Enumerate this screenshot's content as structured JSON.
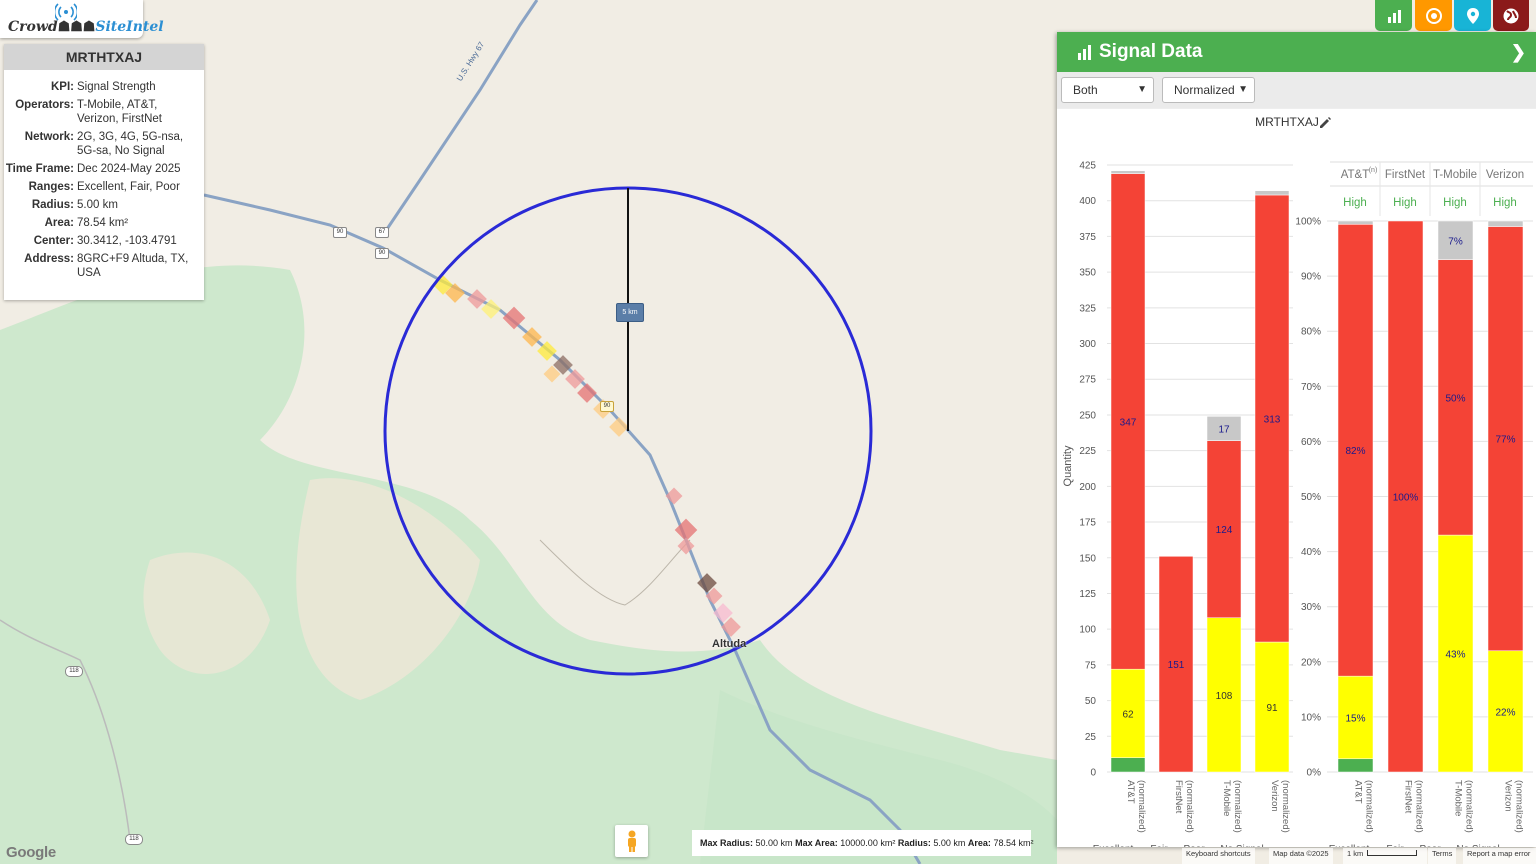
{
  "app": {
    "logo_prefix": "Crowd",
    "logo_suffix": "SiteIntel"
  },
  "info": {
    "title": "MRTHTXAJ",
    "rows": [
      {
        "key": "KPI:",
        "value": "Signal Strength"
      },
      {
        "key": "Operators:",
        "value": "T-Mobile, AT&T, Verizon, FirstNet"
      },
      {
        "key": "Network:",
        "value": "2G, 3G, 4G, 5G-nsa, 5G-sa, No Signal"
      },
      {
        "key": "Time Frame:",
        "value": "Dec 2024-May 2025"
      },
      {
        "key": "Ranges:",
        "value": "Excellent, Fair, Poor"
      },
      {
        "key": "Radius:",
        "value": "5.00 km"
      },
      {
        "key": "Area:",
        "value": "78.54 km²"
      },
      {
        "key": "Center:",
        "value": "30.3412, -103.4791"
      },
      {
        "key": "Address:",
        "value": "8GRC+F9 Altuda, TX, USA"
      }
    ]
  },
  "map": {
    "road_label": "U.S. Hwy 67",
    "shields": [
      "90",
      "67",
      "90",
      "90",
      "118",
      "118"
    ],
    "place_label": "Altuda",
    "scale_label": "5 km",
    "circle_color": "#2a2ad6"
  },
  "toolbar": {
    "buttons": [
      {
        "name": "chart-button",
        "icon": "bar-chart-icon",
        "color": "#4caf50"
      },
      {
        "name": "target-button",
        "icon": "target-icon",
        "color": "#ff9800"
      },
      {
        "name": "pin-button",
        "icon": "map-pin-icon",
        "color": "#18b4d6"
      },
      {
        "name": "globe-button",
        "icon": "globe-icon",
        "color": "#8b1a1a"
      }
    ]
  },
  "panel": {
    "title": "Signal Data",
    "select_mode": "Both",
    "select_scale": "Normalized",
    "chart_title": "MRTHTXAJ"
  },
  "chart_data": [
    {
      "type": "bar",
      "stacked": true,
      "title": "MRTHTXAJ",
      "ylabel": "Quantity",
      "ylim": [
        0,
        425
      ],
      "yticks": [
        0,
        25,
        50,
        75,
        100,
        125,
        150,
        175,
        200,
        225,
        250,
        275,
        300,
        325,
        350,
        375,
        400,
        425
      ],
      "categories": [
        "AT&T (normalized)",
        "FirstNet (normalized)",
        "T-Mobile (normalized)",
        "Verizon (normalized)"
      ],
      "series": [
        {
          "name": "Excellent",
          "color": "#4caf50",
          "values": [
            10,
            0,
            0,
            0
          ],
          "labels": [
            "",
            "",
            "",
            ""
          ]
        },
        {
          "name": "Fair",
          "color": "#ffff00",
          "values": [
            62,
            0,
            108,
            91
          ],
          "labels": [
            "62",
            "",
            "108",
            "91"
          ]
        },
        {
          "name": "Poor",
          "color": "#f44336",
          "values": [
            347,
            151,
            124,
            313
          ],
          "labels": [
            "347",
            "151",
            "124",
            "313"
          ]
        },
        {
          "name": "No Signal",
          "color": "#c8c8c8",
          "values": [
            2,
            0,
            17,
            3
          ],
          "labels": [
            "",
            "",
            "17",
            ""
          ]
        }
      ]
    },
    {
      "type": "bar",
      "stacked": true,
      "ylim": [
        0,
        100
      ],
      "yticks": [
        "0%",
        "10%",
        "20%",
        "30%",
        "40%",
        "50%",
        "60%",
        "70%",
        "80%",
        "90%",
        "100%"
      ],
      "categories": [
        "AT&T (normalized)",
        "FirstNet (normalized)",
        "T-Mobile (normalized)",
        "Verizon (normalized)"
      ],
      "headers": [
        "AT&T",
        "FirstNet",
        "T-Mobile",
        "Verizon"
      ],
      "header_sup": "(n)",
      "confidence": [
        "High",
        "High",
        "High",
        "High"
      ],
      "series": [
        {
          "name": "Excellent",
          "color": "#4caf50",
          "values": [
            2.4,
            0,
            0,
            0
          ],
          "labels": [
            "",
            "",
            "",
            ""
          ]
        },
        {
          "name": "Fair",
          "color": "#ffff00",
          "values": [
            15,
            0,
            43,
            22
          ],
          "labels": [
            "15%",
            "",
            "43%",
            "22%"
          ]
        },
        {
          "name": "Poor",
          "color": "#f44336",
          "values": [
            82,
            100,
            50,
            77
          ],
          "labels": [
            "82%",
            "100%",
            "50%",
            "77%"
          ]
        },
        {
          "name": "No Signal",
          "color": "#c8c8c8",
          "values": [
            0.6,
            0,
            7,
            1
          ],
          "labels": [
            "",
            "",
            "7%",
            ""
          ]
        }
      ]
    }
  ],
  "legend": [
    {
      "label": "Excellent",
      "color": "#4caf50"
    },
    {
      "label": "Fair",
      "color": "#ffff00"
    },
    {
      "label": "Poor",
      "color": "#f44336"
    },
    {
      "label": "No Signal",
      "color": "#c8c8c8"
    }
  ],
  "footer": {
    "max_radius_label": "Max Radius:",
    "max_radius_value": "50.00 km",
    "max_area_label": "Max Area:",
    "max_area_value": "10000.00 km²",
    "radius_label": "Radius:",
    "radius_value": "5.00 km",
    "area_label": "Area:",
    "area_value": "78.54 km²",
    "google": "Google",
    "keyboard": "Keyboard shortcuts",
    "mapdata": "Map data ©2025",
    "scale": "1 km",
    "terms": "Terms",
    "report": "Report a map error"
  }
}
